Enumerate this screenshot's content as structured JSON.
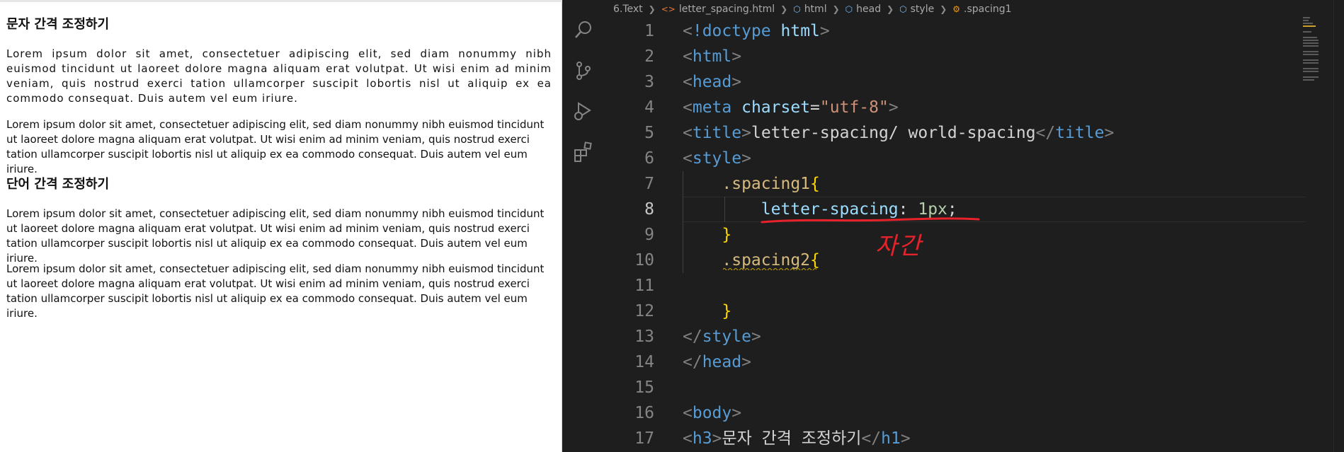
{
  "preview": {
    "heading1": "문자 간격 조정하기",
    "heading2": "단어 간격 조정하기",
    "paragraphs": [
      "Lorem ipsum dolor sit amet, consectetuer adipiscing elit, sed diam nonummy nibh euismod tincidunt ut laoreet dolore magna aliquam erat volutpat. Ut wisi enim ad minim veniam, quis nostrud exerci tation ullamcorper suscipit lobortis nisl ut aliquip ex ea commodo consequat. Duis autem vel eum iriure.",
      "Lorem ipsum dolor sit amet, consectetuer adipiscing elit, sed diam nonummy nibh euismod tincidunt ut laoreet dolore magna aliquam erat volutpat. Ut wisi enim ad minim veniam, quis nostrud exerci tation ullamcorper suscipit lobortis nisl ut aliquip ex ea commodo consequat. Duis autem vel eum iriure.",
      "Lorem ipsum dolor sit amet, consectetuer adipiscing elit, sed diam nonummy nibh euismod tincidunt ut laoreet dolore magna aliquam erat volutpat. Ut wisi enim ad minim veniam, quis nostrud exerci tation ullamcorper suscipit lobortis nisl ut aliquip ex ea commodo consequat. Duis autem vel eum iriure.",
      "Lorem ipsum dolor sit amet, consectetuer adipiscing elit, sed diam nonummy nibh euismod tincidunt ut laoreet dolore magna aliquam erat volutpat. Ut wisi enim ad minim veniam, quis nostrud exerci tation ullamcorper suscipit lobortis nisl ut aliquip ex ea commodo consequat. Duis autem vel eum iriure."
    ]
  },
  "activitybar": {
    "icons": [
      "search-icon",
      "source-control-icon",
      "run-debug-icon",
      "extensions-icon"
    ]
  },
  "breadcrumb": {
    "folder": "6.Text",
    "file": "letter_spacing.html",
    "html": "html",
    "head": "head",
    "style": "style",
    "selector": ".spacing1"
  },
  "editor": {
    "line_numbers": [
      "1",
      "2",
      "3",
      "4",
      "5",
      "6",
      "7",
      "8",
      "9",
      "10",
      "11",
      "12",
      "13",
      "14",
      "15",
      "16",
      "17"
    ],
    "active_line": "8",
    "lines": {
      "l1_doctype": "!doctype",
      "l1_html": "html",
      "l2_tag": "html",
      "l3_tag": "head",
      "l4_tag": "meta",
      "l4_attr": "charset",
      "l4_eq": "=",
      "l4_val": "\"utf-8\"",
      "l5_tag": "title",
      "l5_text": "letter-spacing/ world-spacing",
      "l5_close": "title",
      "l6_tag": "style",
      "l7_sel": ".spacing1",
      "l7_brace": "{",
      "l8_prop": "letter-spacing",
      "l8_colon": ": ",
      "l8_val": "1px",
      "l8_semi": ";",
      "l9_brace": "}",
      "l10_sel": ".spacing2",
      "l10_brace": "{",
      "l12_brace": "}",
      "l13_tag": "style",
      "l14_tag": "head",
      "l16_tag": "body",
      "l17_tag": "h3",
      "l17_text": "문자 간격 조정하기",
      "l17_close": "h1"
    }
  },
  "annotation": {
    "text": "자간"
  },
  "colors": {
    "annotation": "#e8222a",
    "editor_bg": "#1e1e1e",
    "tag": "#569cd6",
    "attr": "#9cdcfe",
    "string": "#ce9178",
    "selector": "#d7ba7d",
    "brace": "#ffd700",
    "number": "#b5cea8"
  }
}
